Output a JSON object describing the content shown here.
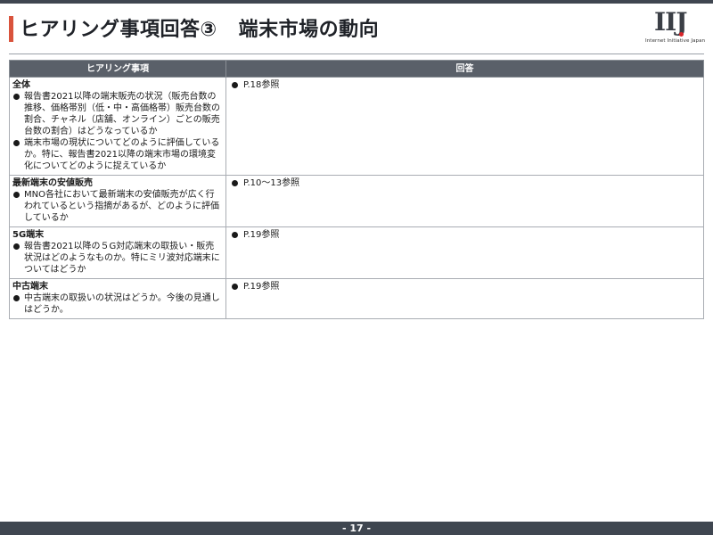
{
  "header": {
    "title_main": "ヒアリング事項回答③",
    "title_sub": "端末市場の動向"
  },
  "logo": {
    "mark": "IIJ",
    "tagline": "Internet Initiative Japan"
  },
  "table": {
    "headers": [
      "ヒアリング事項",
      "回答"
    ],
    "rows": [
      {
        "heading": "全体",
        "questions": [
          "報告書2021以降の端末販売の状況（販売台数の推移、価格帯別（低・中・高価格帯）販売台数の割合、チャネル（店舗、オンライン）ごとの販売台数の割合）はどうなっているか",
          "端末市場の現状についてどのように評価しているか。特に、報告書2021以降の端末市場の環境変化についてどのように捉えているか"
        ],
        "answer": "P.18参照"
      },
      {
        "heading": "最新端末の安値販売",
        "questions": [
          "MNO各社において最新端末の安値販売が広く行われているという指摘があるが、どのように評価しているか"
        ],
        "answer": "P.10～13参照"
      },
      {
        "heading": "5G端末",
        "questions": [
          "報告書2021以降の５G対応端末の取扱い・販売状況はどのようなものか。特にミリ波対応端末についてはどうか"
        ],
        "answer": "P.19参照"
      },
      {
        "heading": "中古端末",
        "questions": [
          "中古端末の取扱いの状況はどうか。今後の見通しはどうか。"
        ],
        "answer": "P.19参照"
      }
    ]
  },
  "footer": {
    "page_number": "- 17 -"
  },
  "colors": {
    "accent": "#d9533c",
    "header_fill": "#5a6069",
    "bar": "#3f4650"
  }
}
